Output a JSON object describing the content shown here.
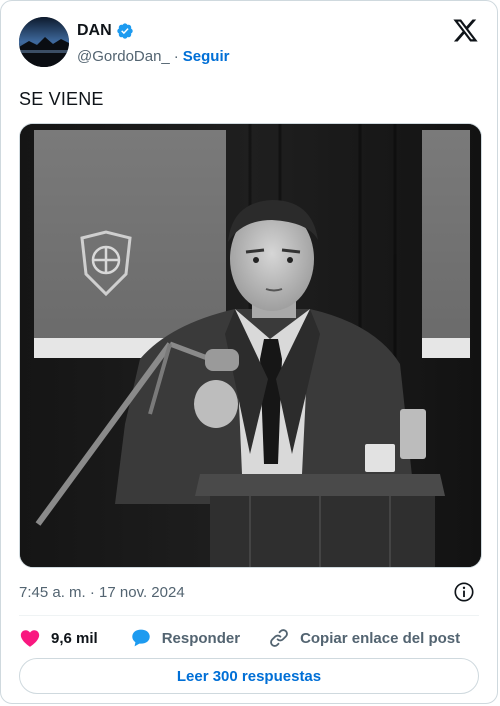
{
  "author": {
    "name": "DAN",
    "handle": "@GordoDan_",
    "separator": "·",
    "follow_label": "Seguir"
  },
  "tweet": {
    "text": "SE VIENE",
    "timestamp": "7:45 a. m. · 17 nov. 2024"
  },
  "actions": {
    "likes": "9,6 mil",
    "reply_label": "Responder",
    "copy_label": "Copiar enlace del post"
  },
  "read_replies_label": "Leer 300 respuestas",
  "colors": {
    "accent": "#006fd6",
    "verified": "#1d9bf0",
    "like": "#f91880",
    "muted": "#536471",
    "border": "#cfd9de"
  },
  "icons": {
    "verified": "verified-badge-icon",
    "brand": "x-logo-icon",
    "info": "info-icon",
    "like": "heart-icon",
    "reply": "speech-bubble-icon",
    "copy": "link-icon"
  }
}
